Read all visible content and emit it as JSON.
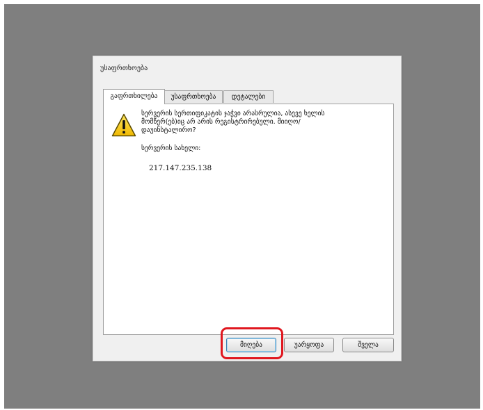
{
  "dialog": {
    "title": "უსაფრთხოება",
    "tabs": [
      {
        "label": "გაფრთხილება",
        "active": true
      },
      {
        "label": "უსაფრთხოება",
        "active": false
      },
      {
        "label": "დეტალები",
        "active": false
      }
    ],
    "message_lines": [
      "სერვერის სერთიფიკატის ჯაჭვი არასრულია, ასევე ხელის",
      "მომწერ(ებ)იც არ არის რეგისტრირებული. მიიღო/",
      "დაუინსტალირო?"
    ],
    "server_name_label": "სერვერის სახელი:",
    "server_ip": "217.147.235.138",
    "icon": "warning-icon",
    "buttons": {
      "accept": "მიღება",
      "reject": "უარყოფა",
      "help": "შველა"
    }
  },
  "colors": {
    "backdrop": "#7f7f7f",
    "highlight": "#e0171f",
    "warning_yellow": "#f5d000"
  }
}
